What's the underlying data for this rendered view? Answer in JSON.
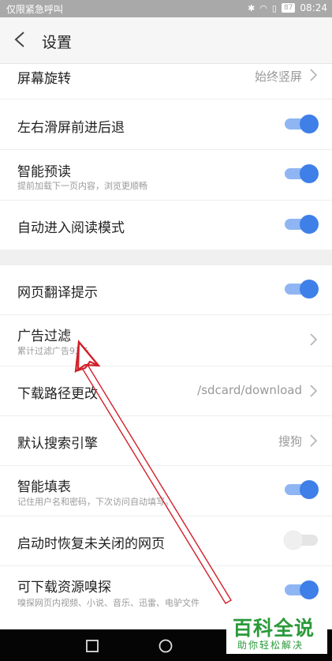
{
  "status_bar": {
    "carrier": "仅限紧急呼叫",
    "battery": "87",
    "time": "08:24"
  },
  "header": {
    "title": "设置",
    "back_icon": "back-arrow-icon"
  },
  "settings": [
    {
      "label": "屏幕旋转",
      "value": "始终竖屏",
      "control": "chevron"
    },
    {
      "label": "左右滑屏前进后退",
      "control": "toggle",
      "on": true
    },
    {
      "label": "智能预读",
      "sub": "提前加载下一页内容，浏览更顺畅",
      "control": "toggle",
      "on": true
    },
    {
      "label": "自动进入阅读模式",
      "control": "toggle",
      "on": true
    },
    {
      "label": "网页翻译提示",
      "control": "toggle",
      "on": true
    },
    {
      "label": "广告过滤",
      "sub": "累计过滤广告93条",
      "control": "chevron"
    },
    {
      "label": "下载路径更改",
      "value": "/sdcard/download",
      "control": "chevron"
    },
    {
      "label": "默认搜索引擎",
      "value": "搜狗",
      "control": "chevron"
    },
    {
      "label": "智能填表",
      "sub": "记住用户名和密码，下次访问自动填写。",
      "control": "toggle",
      "on": true
    },
    {
      "label": "启动时恢复未关闭的网页",
      "control": "toggle",
      "on": false
    },
    {
      "label": "可下载资源嗅探",
      "sub": "嗅探网页内视频、小说、音乐、迅雷、电驴文件",
      "control": "toggle",
      "on": true
    }
  ],
  "watermark": {
    "title": "百科全说",
    "subtitle": "助你轻松解决"
  },
  "colors": {
    "accent": "#3f7fe8",
    "watermark": "#2a9a3a",
    "arrow": "#d21f2a"
  }
}
